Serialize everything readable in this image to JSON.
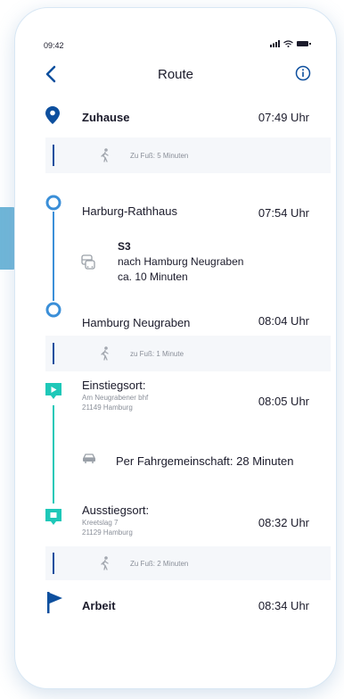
{
  "status": {
    "time": "09:42"
  },
  "header": {
    "title": "Route"
  },
  "stops": {
    "home": {
      "label": "Zuhause",
      "time": "07:49 Uhr"
    },
    "walk1": {
      "label": "Zu Fuß: 5 Minuten"
    },
    "harburg": {
      "label": "Harburg-Rathhaus",
      "time": "07:54 Uhr"
    },
    "train": {
      "line": "S3",
      "direction": "nach Hamburg Neugraben",
      "duration": "ca. 10 Minuten"
    },
    "neugraben": {
      "label": "Hamburg Neugraben",
      "time": "08:04 Uhr"
    },
    "walk2": {
      "label": "zu Fuß: 1 Minute"
    },
    "einstieg": {
      "label": "Einstiegsort:",
      "street": "Am Neugrabener bhf",
      "city": "21149 Hamburg",
      "time": "08:05 Uhr"
    },
    "carpool": {
      "label": "Per Fahrgemeinschaft: 28 Minuten"
    },
    "ausstieg": {
      "label": "Ausstiegsort:",
      "street": "Kreetslag 7",
      "city": "21129 Hamburg",
      "time": "08:32 Uhr"
    },
    "walk3": {
      "label": "Zu Fuß: 2 Minuten"
    },
    "work": {
      "label": "Arbeit",
      "time": "08:34 Uhr"
    }
  },
  "colors": {
    "primary_blue": "#0d4f9e",
    "transit_blue": "#3b8fd8",
    "carpool_teal": "#1ec8b8",
    "text": "#1b1b2b",
    "muted": "#8a8f99",
    "row_bg": "#f5f7fa"
  },
  "icons": [
    "back-chevron-icon",
    "info-icon",
    "location-pin-icon",
    "walk-icon",
    "circle-stop-icon",
    "bus-icon",
    "pickup-marker-icon",
    "car-icon",
    "dropoff-marker-icon",
    "flag-icon",
    "signal-icon",
    "wifi-icon",
    "battery-icon"
  ]
}
